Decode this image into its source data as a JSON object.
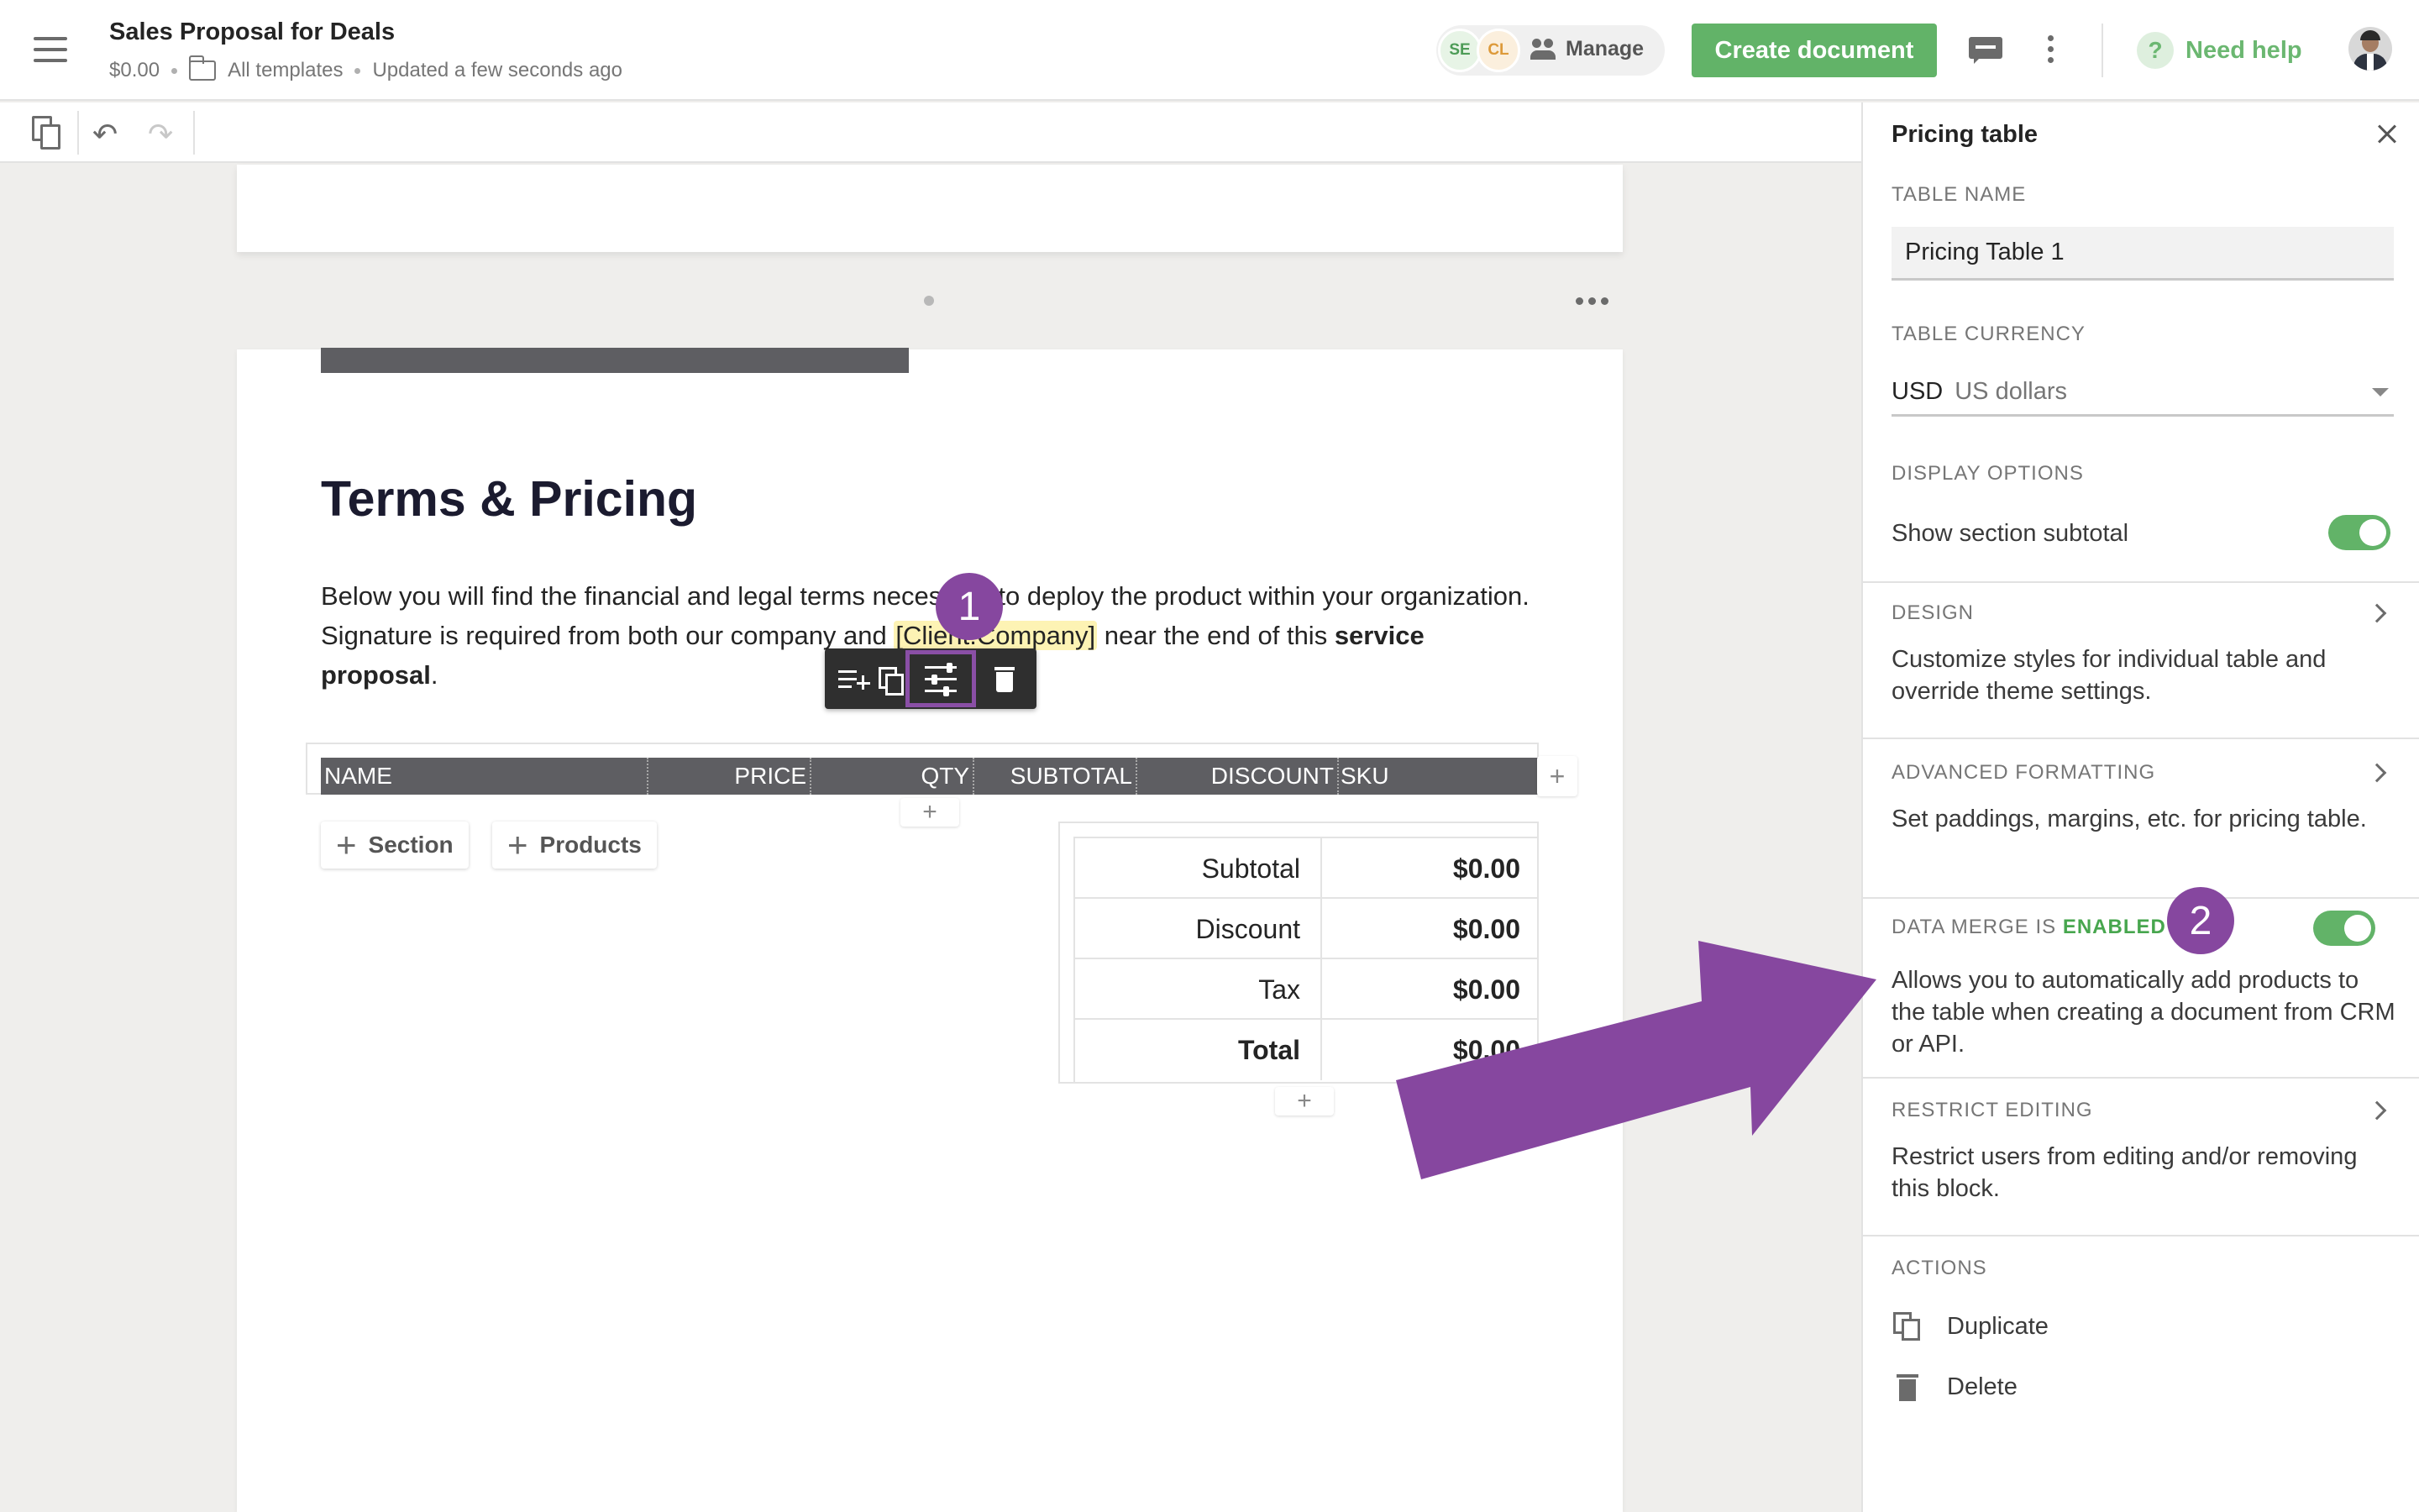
{
  "header": {
    "doc_title": "Sales Proposal for Deals",
    "price": "$0.00",
    "folder": "All templates",
    "updated": "Updated a few seconds ago",
    "collaborators": [
      "SE",
      "CL"
    ],
    "manage_label": "Manage",
    "create_button": "Create document",
    "help_label": "Need help",
    "help_symbol": "?"
  },
  "toolbar": {
    "undo_symbol": "↶",
    "redo_symbol": "↷"
  },
  "document": {
    "heading": "Terms & Pricing",
    "paragraph": {
      "part1": "Below you will find the financial and legal terms necessary to deploy the product within your organization. Signature is required from both our company and ",
      "merge_tag": "[Client.Company]",
      "part2": " near the end of this ",
      "bold": "service proposal",
      "part3": "."
    },
    "pricing_table": {
      "columns": [
        "NAME",
        "PRICE",
        "QTY",
        "SUBTOTAL",
        "DISCOUNT",
        "SKU"
      ],
      "add_section": "Section",
      "add_products": "Products",
      "plus": "+",
      "summary": [
        {
          "label": "Subtotal",
          "value": "$0.00"
        },
        {
          "label": "Discount",
          "value": "$0.00"
        },
        {
          "label": "Tax",
          "value": "$0.00"
        },
        {
          "label": "Total",
          "value": "$0.00"
        }
      ]
    }
  },
  "panel": {
    "title": "Pricing table",
    "table_name_label": "TABLE NAME",
    "table_name_value": "Pricing Table 1",
    "currency_label": "TABLE CURRENCY",
    "currency_code": "USD",
    "currency_name": "US dollars",
    "display_label": "DISPLAY OPTIONS",
    "show_subtotal": "Show section subtotal",
    "design_label": "DESIGN",
    "design_desc": "Customize styles for individual table and override theme settings.",
    "advanced_label": "ADVANCED FORMATTING",
    "advanced_desc": "Set paddings, margins, etc. for pricing table.",
    "data_merge_label": "DATA MERGE IS",
    "data_merge_state": "ENABLED",
    "data_merge_desc": "Allows you to automatically add products to the table when creating a document from CRM or API.",
    "restrict_label": "RESTRICT EDITING",
    "restrict_desc": "Restrict users from editing and/or removing this block.",
    "actions_label": "ACTIONS",
    "duplicate": "Duplicate",
    "delete": "Delete"
  },
  "annotations": {
    "badge1": "1",
    "badge2": "2",
    "color": "#86479f"
  },
  "colors": {
    "accent_green": "#47a64e",
    "table_header": "#5e5e62",
    "merge_highlight": "#fdf3b4"
  }
}
